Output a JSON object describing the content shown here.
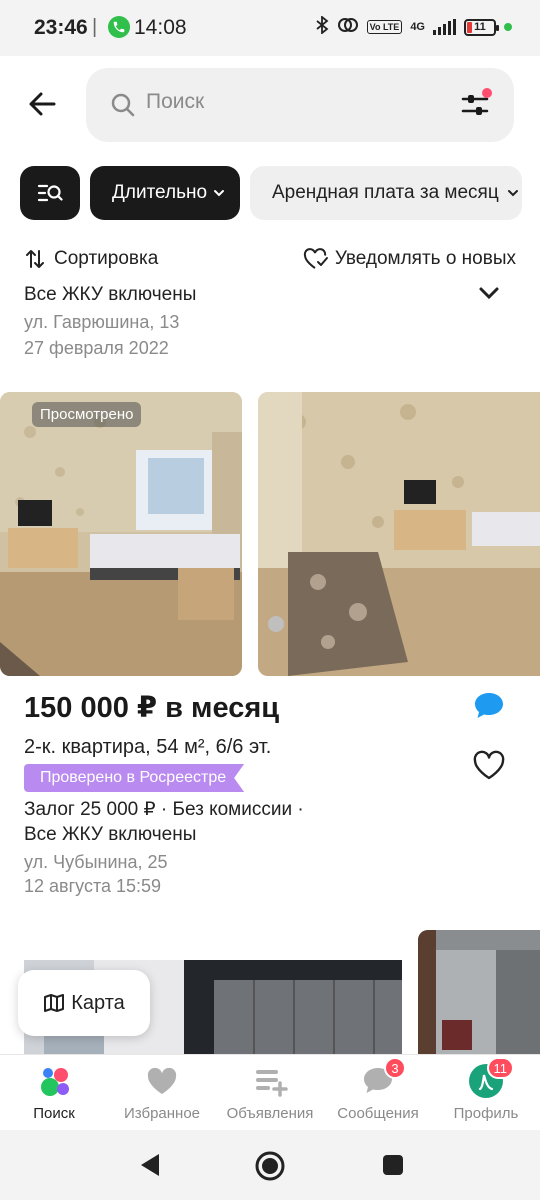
{
  "status_bar": {
    "time": "23:46",
    "separator": "|",
    "call_time": "14:08",
    "battery": "11",
    "network": "4G",
    "volte": "Vo LTE"
  },
  "search": {
    "placeholder": "Поиск"
  },
  "chips": {
    "duration": "Длительно",
    "rent": "Арендная плата за месяц"
  },
  "toolbar": {
    "sort": "Сортировка",
    "notify": "Уведомлять о новых"
  },
  "previous_listing": {
    "terms_tail": "Все ЖКУ включены",
    "address": "ул. Гаврюшина, 13",
    "date": "27 февраля 2022"
  },
  "listing": {
    "viewed_label": "Просмотрено",
    "price": "150 000 ₽ в месяц",
    "title": "2-к. квартира, 54 м², 6/6 эт.",
    "badge": "Проверено в Росреестре",
    "terms_line1": "Залог 25 000 ₽ · Без комиссии ·",
    "terms_line2": "Все ЖКУ включены",
    "address": "ул. Чубынина, 25",
    "date": "12 августа 15:59"
  },
  "map_button": "Карта",
  "bottom_nav": [
    {
      "label": "Поиск",
      "icon": "search-nav-icon",
      "active": true
    },
    {
      "label": "Избранное",
      "icon": "heart-icon"
    },
    {
      "label": "Объявления",
      "icon": "listings-icon"
    },
    {
      "label": "Сообщения",
      "icon": "chat-icon",
      "badge": "3"
    },
    {
      "label": "Профиль",
      "icon": "avatar",
      "badge": "11"
    }
  ],
  "colors": {
    "accent_purple": "#b98bf0",
    "badge_red": "#ff4d5e",
    "chat_blue": "#1e9bf0",
    "dark_chip": "#1a1a1a"
  }
}
